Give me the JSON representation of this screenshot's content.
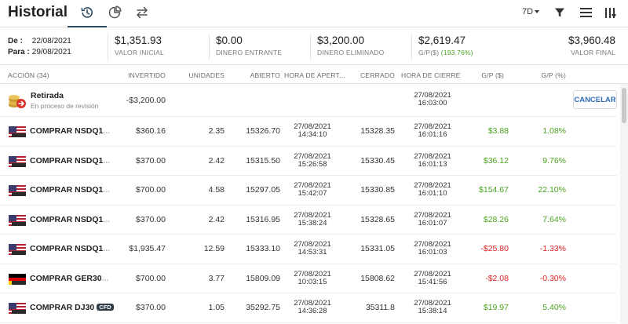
{
  "header": {
    "title": "Historial",
    "period": "7D"
  },
  "summary": {
    "from_label": "De :",
    "from_date": "22/08/2021",
    "to_label": "Para :",
    "to_date": "29/08/2021",
    "initial_value": "$1,351.93",
    "initial_label": "VALOR INICIAL",
    "money_in": "$0.00",
    "money_in_label": "DINERO ENTRANTE",
    "money_out": "$3,200.00",
    "money_out_label": "DINERO ELIMINADO",
    "pl": "$2,619.47",
    "pl_label": "G/P($)",
    "pl_pct": "(193.76%)",
    "final_value": "$3,960.48",
    "final_label": "VALOR FINAL"
  },
  "columns": {
    "action": "ACCIÓN (34)",
    "invested": "INVERTIDO",
    "units": "UNIDADES",
    "open": "ABIERTO",
    "open_time": "HORA DE APERT...",
    "closed": "CERRADO",
    "close_time": "HORA DE CIERRE",
    "pl_usd": "G/P ($)",
    "pl_pct": "G/P (%)"
  },
  "withdrawal": {
    "title": "Retirada",
    "subtitle": "En proceso de revisión",
    "amount": "-$3,200.00",
    "date": "27/08/2021",
    "time": "16:03:00",
    "cancel_label": "CANCELAR"
  },
  "trades": [
    {
      "name": "COMPRAR NSDQ1",
      "flag": "us",
      "invested": "$360.16",
      "units": "2.35",
      "open": "15326.70",
      "open_date": "27/08/2021",
      "open_time": "14:34:10",
      "closed": "15328.35",
      "close_date": "27/08/2021",
      "close_time": "16:01:16",
      "pl": "$3.88",
      "pl_pct": "1.08%",
      "sign": "pos"
    },
    {
      "name": "COMPRAR NSDQ1",
      "flag": "us",
      "invested": "$370.00",
      "units": "2.42",
      "open": "15315.50",
      "open_date": "27/08/2021",
      "open_time": "15:26:58",
      "closed": "15330.45",
      "close_date": "27/08/2021",
      "close_time": "16:01:13",
      "pl": "$36.12",
      "pl_pct": "9.76%",
      "sign": "pos"
    },
    {
      "name": "COMPRAR NSDQ1",
      "flag": "us",
      "invested": "$700.00",
      "units": "4.58",
      "open": "15297.05",
      "open_date": "27/08/2021",
      "open_time": "15:42:07",
      "closed": "15330.85",
      "close_date": "27/08/2021",
      "close_time": "16:01:10",
      "pl": "$154.67",
      "pl_pct": "22.10%",
      "sign": "pos"
    },
    {
      "name": "COMPRAR NSDQ1",
      "flag": "us",
      "invested": "$370.00",
      "units": "2.42",
      "open": "15316.95",
      "open_date": "27/08/2021",
      "open_time": "15:38:24",
      "closed": "15328.65",
      "close_date": "27/08/2021",
      "close_time": "16:01:07",
      "pl": "$28.26",
      "pl_pct": "7.64%",
      "sign": "pos"
    },
    {
      "name": "COMPRAR NSDQ1",
      "flag": "us",
      "invested": "$1,935.47",
      "units": "12.59",
      "open": "15333.10",
      "open_date": "27/08/2021",
      "open_time": "14:53:31",
      "closed": "15331.05",
      "close_date": "27/08/2021",
      "close_time": "16:01:03",
      "pl": "-$25.80",
      "pl_pct": "-1.33%",
      "sign": "neg"
    },
    {
      "name": "COMPRAR GER30",
      "flag": "de",
      "invested": "$700.00",
      "units": "3.77",
      "open": "15809.09",
      "open_date": "27/08/2021",
      "open_time": "10:03:15",
      "closed": "15808.62",
      "close_date": "27/08/2021",
      "close_time": "15:41:56",
      "pl": "-$2.08",
      "pl_pct": "-0.30%",
      "sign": "neg"
    },
    {
      "name": "COMPRAR DJ30",
      "flag": "us",
      "invested": "$370.00",
      "units": "1.05",
      "open": "35292.75",
      "open_date": "27/08/2021",
      "open_time": "14:36:28",
      "closed": "35311.8",
      "close_date": "27/08/2021",
      "close_time": "15:38:14",
      "pl": "$19.97",
      "pl_pct": "5.40%",
      "sign": "pos",
      "badge": "CFD"
    }
  ],
  "colors": {
    "positive": "#4aa31f",
    "negative": "#dd2222",
    "accent": "#2e4a62",
    "link": "#2d6db5"
  }
}
